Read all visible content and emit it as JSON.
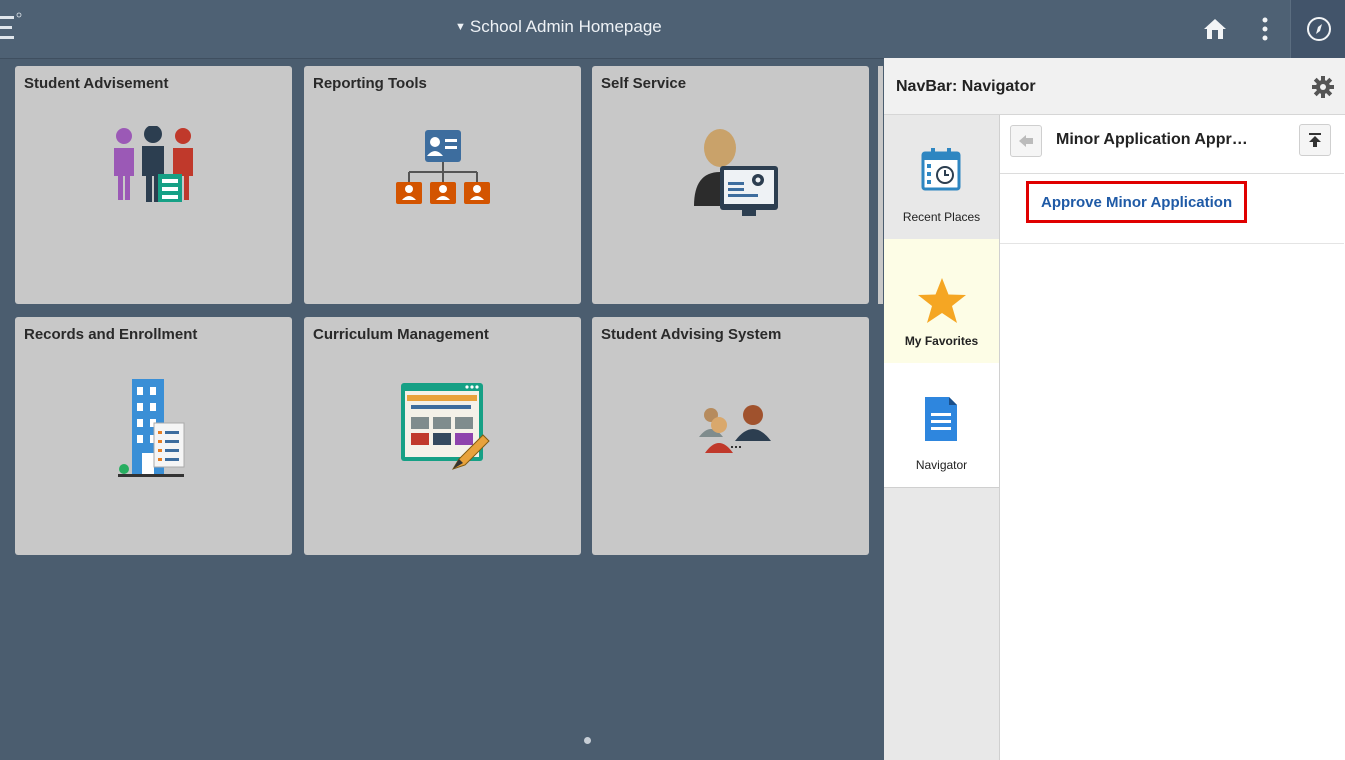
{
  "header": {
    "title": "School Admin Homepage",
    "icons": [
      "logo-icon",
      "home-icon",
      "kebab-menu-icon",
      "compass-icon"
    ]
  },
  "tiles": [
    {
      "label": "Student Advisement",
      "icon": "people-group-icon"
    },
    {
      "label": "Reporting Tools",
      "icon": "org-chart-icon"
    },
    {
      "label": "Self Service",
      "icon": "person-monitor-icon"
    },
    {
      "label": "Records and Enrollment",
      "icon": "building-document-icon"
    },
    {
      "label": "Curriculum Management",
      "icon": "webpage-pencil-icon"
    },
    {
      "label": "Student Advising System",
      "icon": "people-connect-icon"
    }
  ],
  "navbar": {
    "title": "NavBar: Navigator",
    "rail": [
      {
        "label": "Recent Places",
        "icon": "calendar-clock-icon"
      },
      {
        "label": "My Favorites",
        "icon": "star-icon"
      },
      {
        "label": "Navigator",
        "icon": "document-icon"
      }
    ],
    "breadcrumb": "Minor Application Appr…",
    "links": [
      "Approve Minor Application"
    ]
  },
  "colors": {
    "header_bg": "#4e6174",
    "body_bg": "#4b5d6f",
    "tile_bg": "#c8c8c8",
    "link": "#1f5aa6",
    "highlight_border": "#e00000",
    "star": "#f5a623"
  }
}
